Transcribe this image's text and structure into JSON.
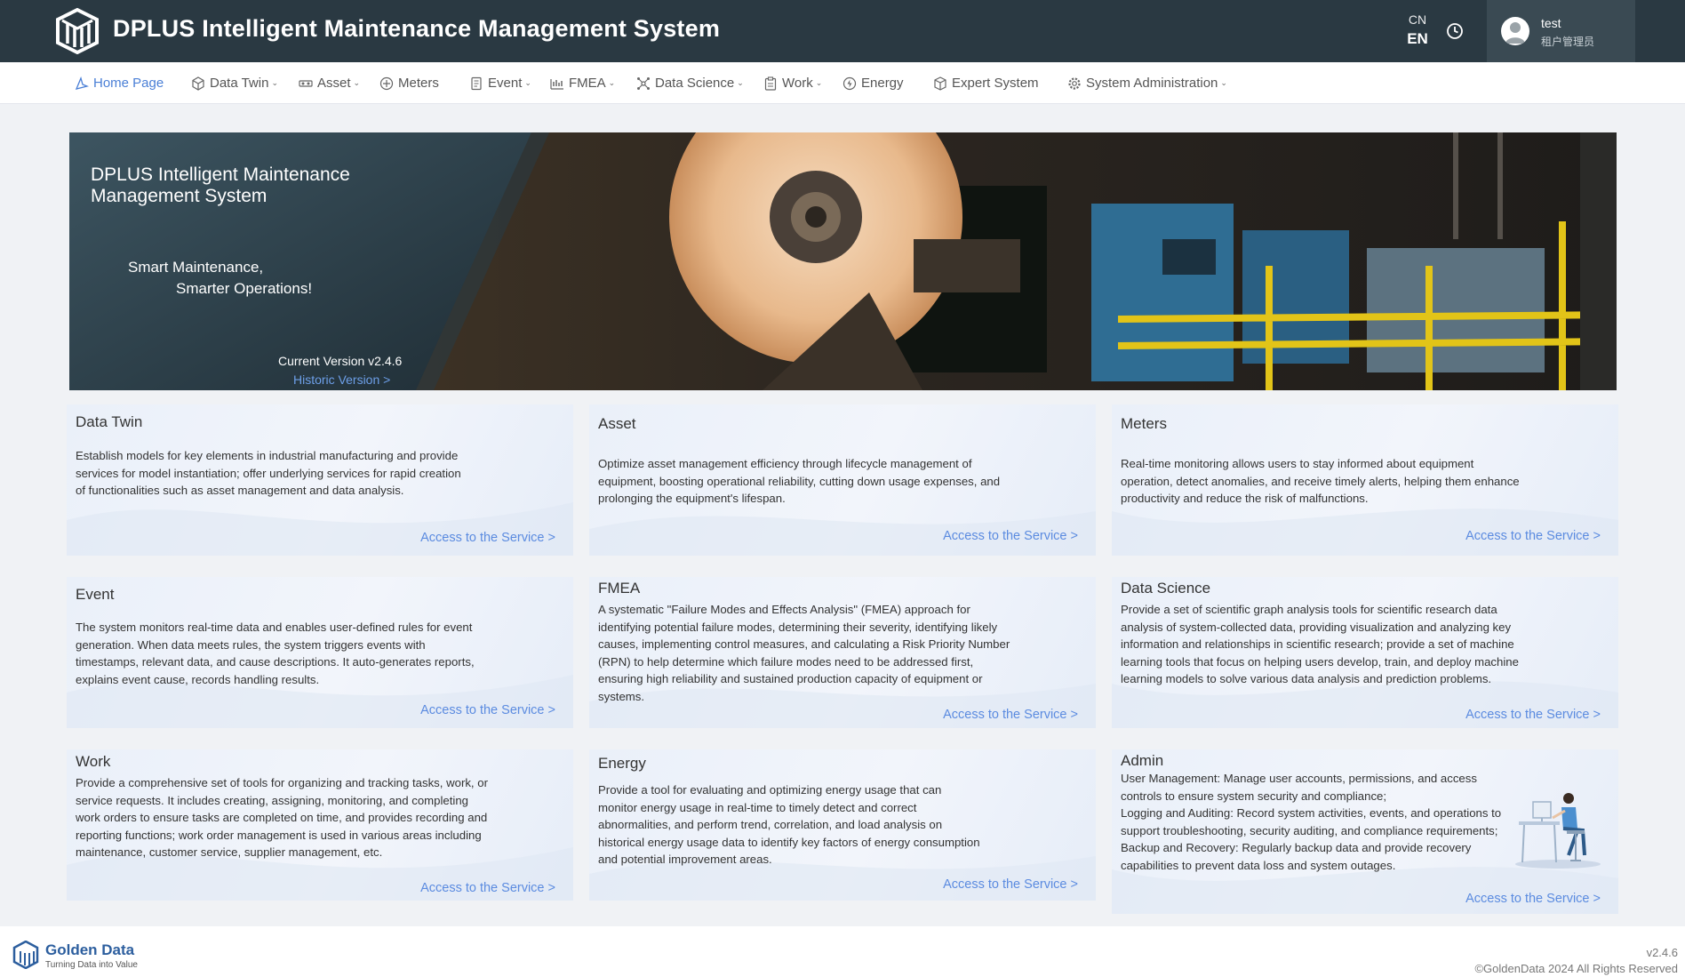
{
  "header": {
    "title": "DPLUS Intelligent Maintenance Management System",
    "lang_cn": "CN",
    "lang_en": "EN",
    "user_name": "test",
    "user_role": "租户管理员"
  },
  "nav": {
    "items": [
      {
        "label": "Home Page",
        "icon": "home-icon",
        "active": true
      },
      {
        "label": "Data Twin",
        "icon": "cube-icon",
        "dropdown": true
      },
      {
        "label": "Asset",
        "icon": "asset-icon",
        "dropdown": true
      },
      {
        "label": "Meters",
        "icon": "meter-icon"
      },
      {
        "label": "Event",
        "icon": "event-icon",
        "dropdown": true
      },
      {
        "label": "FMEA",
        "icon": "chart-icon",
        "dropdown": true
      },
      {
        "label": "Data Science",
        "icon": "molecule-icon",
        "dropdown": true
      },
      {
        "label": "Work",
        "icon": "clipboard-icon",
        "dropdown": true
      },
      {
        "label": "Energy",
        "icon": "energy-icon"
      },
      {
        "label": "Expert System",
        "icon": "box-icon"
      },
      {
        "label": "System Administration",
        "icon": "gear-icon",
        "dropdown": true
      }
    ]
  },
  "banner": {
    "title": "DPLUS Intelligent Maintenance Management System",
    "slogan_line1": "Smart Maintenance,",
    "slogan_line2": "Smarter Operations!",
    "version": "Current Version v2.4.6",
    "historic": "Historic Version >"
  },
  "cards": [
    {
      "title": "Data Twin",
      "description": "Establish models for key elements in industrial manufacturing and provide services for model instantiation; offer underlying services for rapid creation of functionalities such as asset management and data analysis.",
      "link": "Access to the Service >"
    },
    {
      "title": "Asset",
      "description": "Optimize asset management efficiency through lifecycle management of equipment, boosting operational reliability, cutting down usage expenses, and prolonging the equipment's lifespan.",
      "link": "Access to the Service >"
    },
    {
      "title": "Meters",
      "description": "Real-time monitoring allows users to stay informed about equipment operation, detect anomalies, and receive timely alerts, helping them enhance productivity and reduce the risk of malfunctions.",
      "link": "Access to the Service >"
    },
    {
      "title": "Event",
      "description": "The system monitors real-time data and enables user-defined rules for event generation. When data meets rules, the system triggers events with timestamps, relevant data, and cause descriptions. It auto-generates reports, explains event cause, records handling results.",
      "link": "Access to the Service >"
    },
    {
      "title": "FMEA",
      "description": "A systematic \"Failure Modes and Effects Analysis\" (FMEA) approach for identifying potential failure modes, determining their severity, identifying likely causes, implementing control measures, and calculating a Risk Priority Number (RPN) to help determine which failure modes need to be addressed first, ensuring high reliability and sustained production capacity of equipment or systems.",
      "link": "Access to the Service >"
    },
    {
      "title": "Data Science",
      "description": "Provide a set of scientific graph analysis tools for scientific research data analysis of system-collected data, providing visualization and analyzing key information and relationships in scientific research; provide a set of machine learning tools that focus on helping users develop, train, and deploy machine learning models to solve various data analysis and prediction problems.",
      "link": "Access to the Service >"
    },
    {
      "title": "Work",
      "description": "Provide a comprehensive set of tools for organizing and tracking tasks, work, or service requests. It includes creating, assigning, monitoring, and completing work orders to ensure tasks are completed on time, and provides recording and reporting functions; work order management is used in various areas including maintenance, customer service, supplier management, etc.",
      "link": "Access to the Service >"
    },
    {
      "title": "Energy",
      "description": "Provide a tool for evaluating and optimizing energy usage that can monitor energy usage in real-time to timely detect and correct abnormalities, and perform trend, correlation, and load analysis on historical energy usage data to identify key factors of energy consumption and potential improvement areas.",
      "link": "Access to the Service >"
    },
    {
      "title": "Admin",
      "description": "User Management: Manage user accounts, permissions, and access controls to ensure system security and compliance;\nLogging and Auditing: Record system activities, events, and operations to support troubleshooting, security auditing, and compliance requirements;\nBackup and Recovery: Regularly backup data and provide recovery capabilities to prevent data loss and system outages.",
      "link": "Access to the Service >"
    }
  ],
  "footer": {
    "brand": "Golden Data",
    "tagline": "Turning Data into Value",
    "version": "v2.4.6",
    "copyright": "©GoldenData 2024 All Rights Reserved"
  },
  "colors": {
    "header_bg": "#2a3942",
    "accent": "#4a7fd6",
    "link": "#5b8be0",
    "page_bg": "#f0f2f5"
  }
}
